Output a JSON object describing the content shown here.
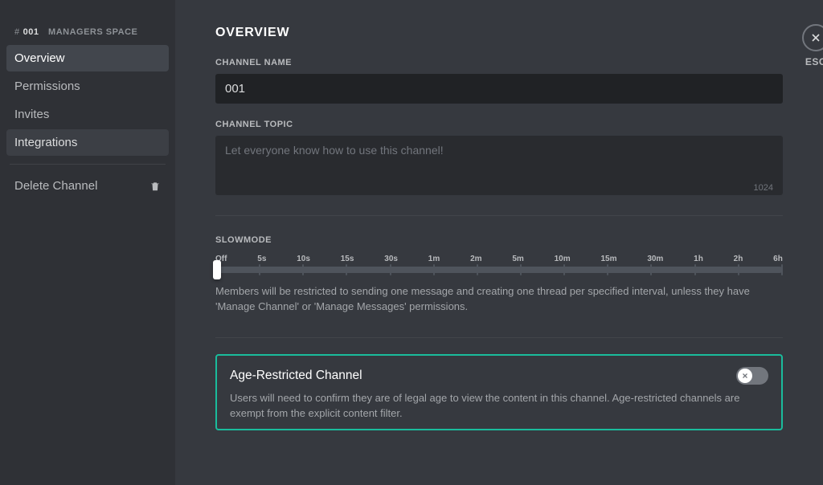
{
  "channel": {
    "prefix": "#",
    "name": "001",
    "server": "MANAGERS SPACE"
  },
  "sidebar": {
    "items": [
      {
        "label": "Overview"
      },
      {
        "label": "Permissions"
      },
      {
        "label": "Invites"
      },
      {
        "label": "Integrations"
      }
    ],
    "delete_label": "Delete Channel"
  },
  "close": {
    "esc": "ESC"
  },
  "overview": {
    "title": "OVERVIEW",
    "name_label": "CHANNEL NAME",
    "name_value": "001",
    "topic_label": "CHANNEL TOPIC",
    "topic_placeholder": "Let everyone know how to use this channel!",
    "topic_value": "",
    "topic_char_limit": "1024",
    "slowmode_label": "SLOWMODE",
    "slowmode_ticks": [
      "Off",
      "5s",
      "10s",
      "15s",
      "30s",
      "1m",
      "2m",
      "5m",
      "10m",
      "15m",
      "30m",
      "1h",
      "2h",
      "6h"
    ],
    "slowmode_help": "Members will be restricted to sending one message and creating one thread per specified interval, unless they have 'Manage Channel' or 'Manage Messages' permissions.",
    "age": {
      "title": "Age-Restricted Channel",
      "desc": "Users will need to confirm they are of legal age to view the content in this channel. Age-restricted channels are exempt from the explicit content filter.",
      "enabled": false
    }
  }
}
